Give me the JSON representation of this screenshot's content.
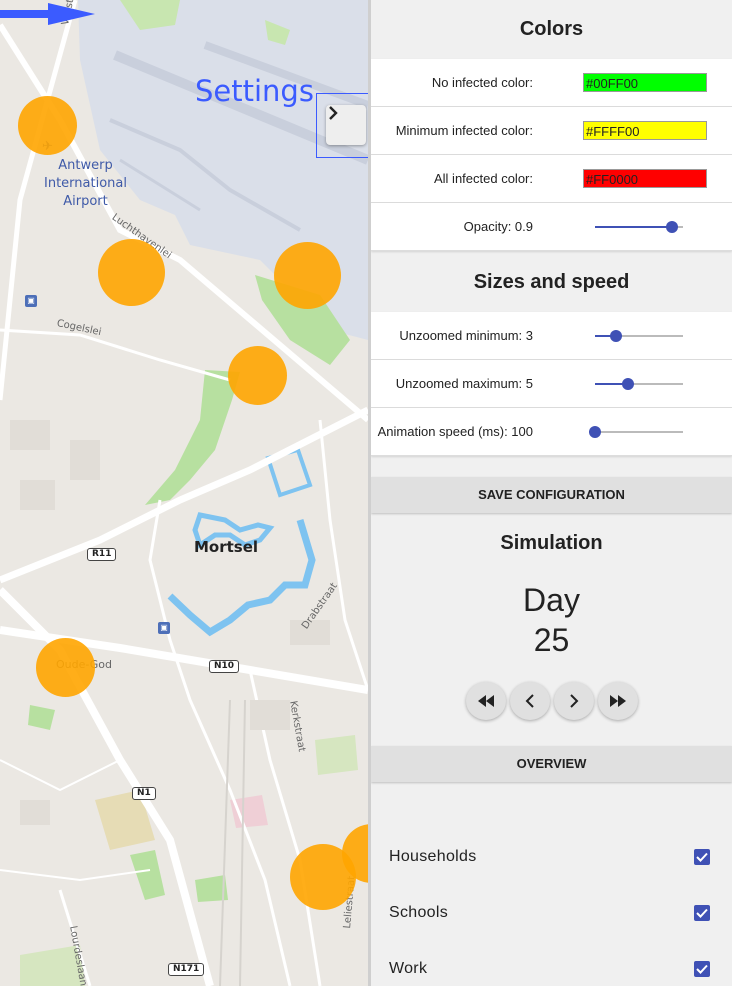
{
  "map": {
    "airport_label_lines": [
      "Antwerp",
      "International",
      "Airport"
    ],
    "streets": {
      "vosstraat": "Vosstraat",
      "luchthavenlei": "Luchthavenlei",
      "cogelslei": "Cogelslei",
      "drabstraat": "Drabstraat",
      "kerkstraat": "Kerkstraat",
      "lourdeslaan": "Lourdeslaan",
      "leliestraat": "Leliestraat"
    },
    "road_shields": {
      "r11": "R11",
      "n10": "N10",
      "n1": "N1",
      "n171": "N171"
    },
    "towns": {
      "mortsel": "Mortsel",
      "oude_god": "Oude-God"
    },
    "infection_color": "#FFA500"
  },
  "annotation": {
    "text": "Settings",
    "color": "#3b5bff"
  },
  "toggle_button": {
    "icon": "chevron-right-icon"
  },
  "colors_section": {
    "title": "Colors",
    "no_infected": {
      "label": "No infected color:",
      "value": "#00FF00"
    },
    "minimum_infected": {
      "label": "Minimum infected color:",
      "value": "#FFFF00"
    },
    "all_infected": {
      "label": "All infected color:",
      "value": "#FF0000"
    },
    "opacity": {
      "label": "Opacity: 0.9",
      "value": 0.9
    }
  },
  "sizes_section": {
    "title": "Sizes and speed",
    "unzoomed_minimum": {
      "label": "Unzoomed minimum: 3",
      "value_fraction": 0.24
    },
    "unzoomed_maximum": {
      "label": "Unzoomed maximum: 5",
      "value_fraction": 0.37
    },
    "animation_speed": {
      "label": "Animation speed (ms): 100",
      "value_fraction": 0.0
    }
  },
  "save_button": {
    "label": "SAVE CONFIGURATION"
  },
  "simulation": {
    "title": "Simulation",
    "day_label": "Day",
    "day_number": "25",
    "controls": [
      "fast-rewind-icon",
      "chevron-left-icon",
      "chevron-right-icon",
      "fast-forward-icon"
    ]
  },
  "overview_button": {
    "label": "OVERVIEW"
  },
  "layers": [
    {
      "label": "Households",
      "checked": true
    },
    {
      "label": "Schools",
      "checked": true
    },
    {
      "label": "Work",
      "checked": true
    }
  ],
  "accent_color": "#3f51b5"
}
